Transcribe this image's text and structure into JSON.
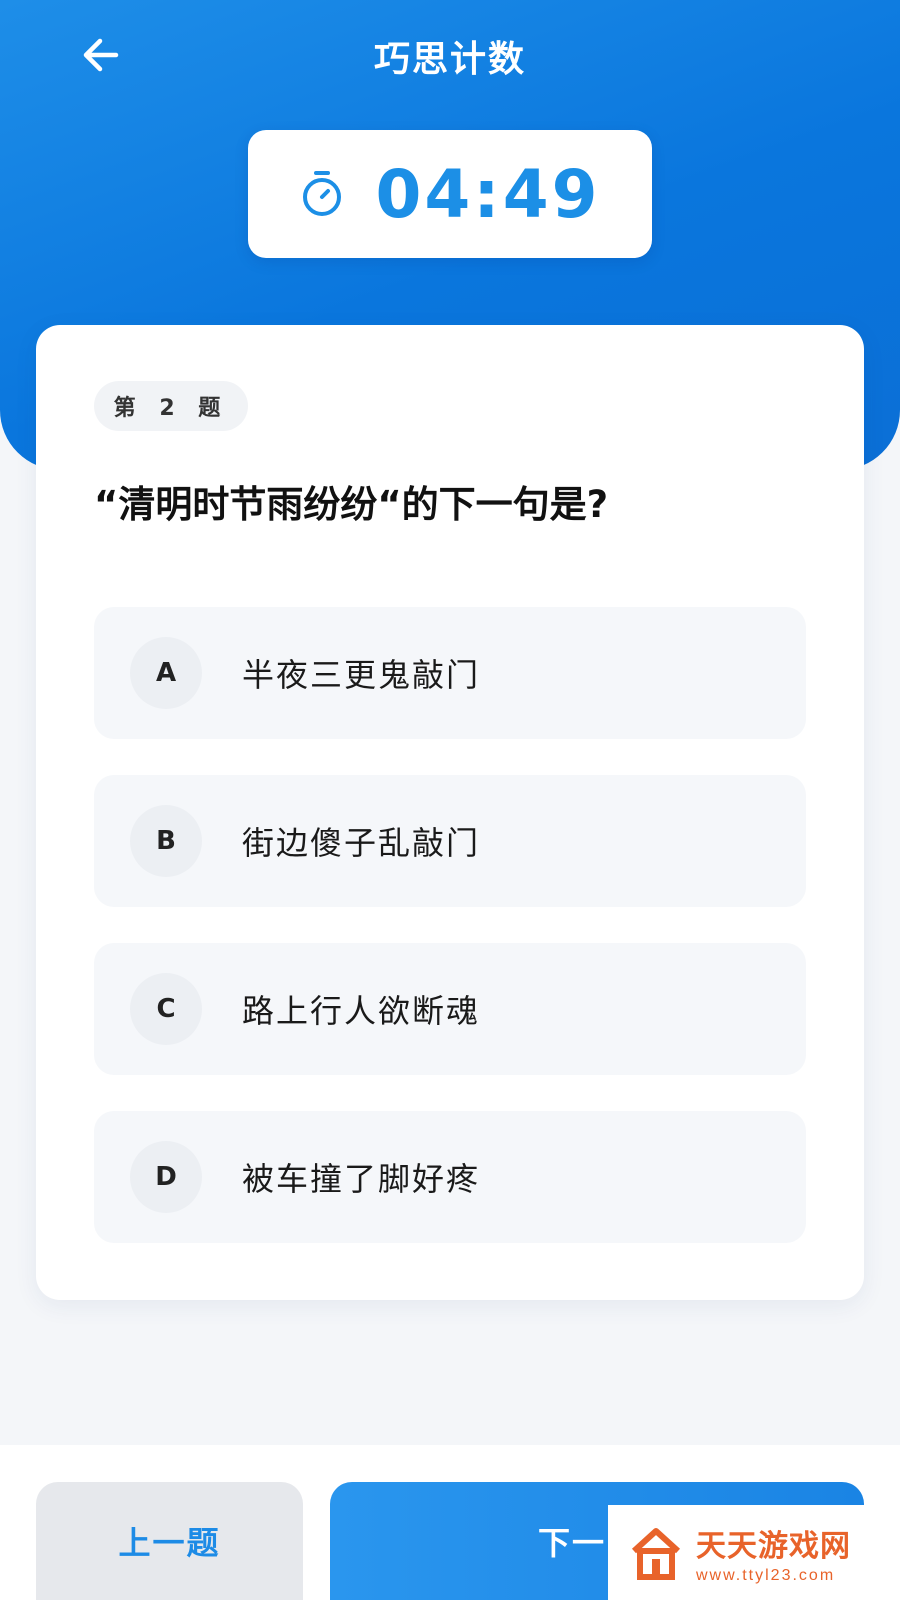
{
  "header": {
    "title": "巧思计数",
    "back_icon": "arrow-left-icon"
  },
  "timer": {
    "icon": "stopwatch-icon",
    "value": "04:49"
  },
  "question": {
    "badge": "第 2 题",
    "text": "“清明时节雨纷纷“的下一句是?",
    "options": [
      {
        "letter": "A",
        "text": "半夜三更鬼敲门"
      },
      {
        "letter": "B",
        "text": "街边傻子乱敲门"
      },
      {
        "letter": "C",
        "text": "路上行人欲断魂"
      },
      {
        "letter": "D",
        "text": "被车撞了脚好疼"
      }
    ]
  },
  "footer": {
    "prev_label": "上一题",
    "next_label": "下一"
  },
  "watermark": {
    "name": "天天游戏网",
    "url": "www.ttyl23.com",
    "logo_icon": "house-logo-icon"
  },
  "colors": {
    "header_blue": "#0a76dd",
    "accent_blue": "#1c8fe6",
    "watermark_orange": "#e8632a"
  }
}
